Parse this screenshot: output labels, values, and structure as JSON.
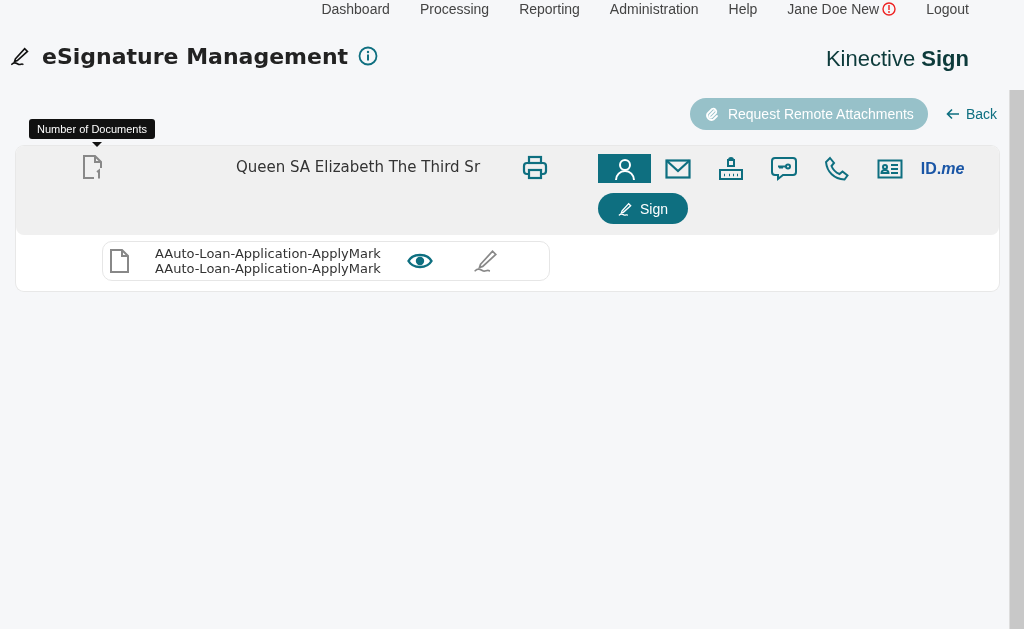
{
  "nav": [
    {
      "label": "Dashboard",
      "alert": false
    },
    {
      "label": "Processing",
      "alert": false
    },
    {
      "label": "Reporting",
      "alert": false
    },
    {
      "label": "Administration",
      "alert": false
    },
    {
      "label": "Help",
      "alert": false
    },
    {
      "label": "Jane Doe New",
      "alert": true
    },
    {
      "label": "Logout",
      "alert": false
    }
  ],
  "page_title": "eSignature Management",
  "brand": "Kinective **Sign**",
  "actions": {
    "request_button": {
      "label": "Request Remote Attachments",
      "disabled": true
    },
    "back_link": "Back"
  },
  "tooltip": "Number of Documents",
  "signer": {
    "name": "Queen SA Elizabeth The Third Sr",
    "auth_methods": [
      {
        "kind": "person",
        "selected": true
      },
      {
        "kind": "email",
        "selected": false
      },
      {
        "kind": "password",
        "selected": false
      },
      {
        "kind": "sms",
        "selected": false
      },
      {
        "kind": "phone",
        "selected": false
      },
      {
        "kind": "idcard",
        "selected": false
      },
      {
        "kind": "idme",
        "label": "ID.*me*",
        "selected": false
      }
    ],
    "sign_button": "Sign"
  },
  "documents": [
    {
      "lines": [
        "AAuto-Loan-Application-ApplyMark",
        "AAuto-Loan-Application-ApplyMark"
      ]
    }
  ]
}
